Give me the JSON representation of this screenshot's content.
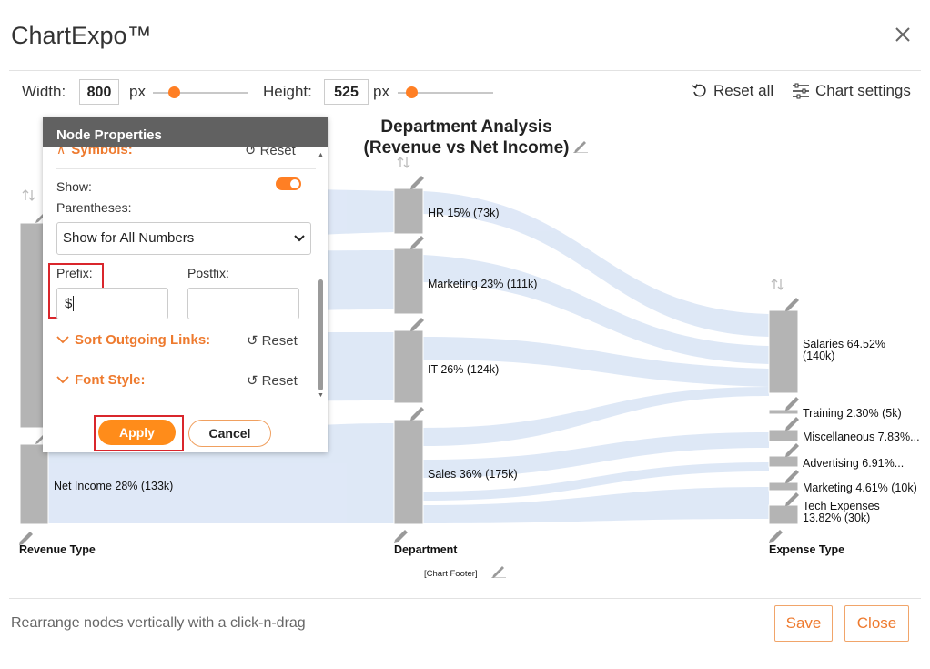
{
  "app": {
    "title": "ChartExpo™"
  },
  "toolbar": {
    "width_label": "Width:",
    "width_value": "800",
    "width_unit": "px",
    "height_label": "Height:",
    "height_value": "525",
    "height_unit": "px",
    "reset_all": "Reset all",
    "chart_settings": "Chart settings"
  },
  "chart": {
    "title_line1": "Department Analysis",
    "title_line2": "(Revenue vs Net Income)",
    "footer": "[Chart Footer]",
    "axis_labels": [
      "Revenue Type",
      "Department",
      "Expense Type"
    ]
  },
  "chart_data": {
    "type": "sankey",
    "title": "Department Analysis (Revenue vs Net Income)",
    "columns": [
      "Revenue Type",
      "Department",
      "Expense Type"
    ],
    "nodes": {
      "Revenue Type": [
        {
          "label": "",
          "value": null
        },
        {
          "label": "Net Income 28% (133k)",
          "name": "Net Income",
          "percent": 28,
          "value": 133
        }
      ],
      "Department": [
        {
          "label": "HR 15% (73k)",
          "name": "HR",
          "percent": 15,
          "value": 73
        },
        {
          "label": "Marketing 23% (111k)",
          "name": "Marketing",
          "percent": 23,
          "value": 111
        },
        {
          "label": "IT 26% (124k)",
          "name": "IT",
          "percent": 26,
          "value": 124
        },
        {
          "label": "Sales 36% (175k)",
          "name": "Sales",
          "percent": 36,
          "value": 175
        }
      ],
      "Expense Type": [
        {
          "label1": "Salaries 64.52%",
          "label2": "(140k)",
          "name": "Salaries",
          "percent": 64.52,
          "value": 140
        },
        {
          "label1": "Training 2.30% (5k)",
          "label2": "",
          "name": "Training",
          "percent": 2.3,
          "value": 5
        },
        {
          "label1": "Miscellaneous 7.83%...",
          "label2": "",
          "name": "Miscellaneous",
          "percent": 7.83,
          "value": null
        },
        {
          "label1": "Advertising 6.91%...",
          "label2": "",
          "name": "Advertising",
          "percent": 6.91,
          "value": null
        },
        {
          "label1": "Marketing 4.61% (10k)",
          "label2": "",
          "name": "Marketing",
          "percent": 4.61,
          "value": 10
        },
        {
          "label1": "Tech Expenses",
          "label2": "13.82% (30k)",
          "name": "Tech Expenses",
          "percent": 13.82,
          "value": 30
        }
      ]
    }
  },
  "dialog": {
    "title": "Node Properties",
    "symbols_section": "Symbols:",
    "symbols_reset": "Reset",
    "show_label": "Show:",
    "show_enabled": true,
    "parentheses_label": "Parentheses:",
    "parentheses_value": "Show for All Numbers",
    "prefix_label": "Prefix:",
    "prefix_value": "$",
    "postfix_label": "Postfix:",
    "postfix_value": "",
    "sort_section": "Sort Outgoing Links:",
    "sort_reset": "Reset",
    "font_section": "Font Style:",
    "font_reset": "Reset",
    "apply": "Apply",
    "cancel": "Cancel"
  },
  "footer": {
    "hint": "Rearrange nodes vertically with a click-n-drag",
    "save": "Save",
    "close": "Close"
  },
  "colors": {
    "accent": "#ff7f24",
    "link": "#dbe6f6",
    "node": "#b4b4b4",
    "highlight": "#d9262c"
  }
}
